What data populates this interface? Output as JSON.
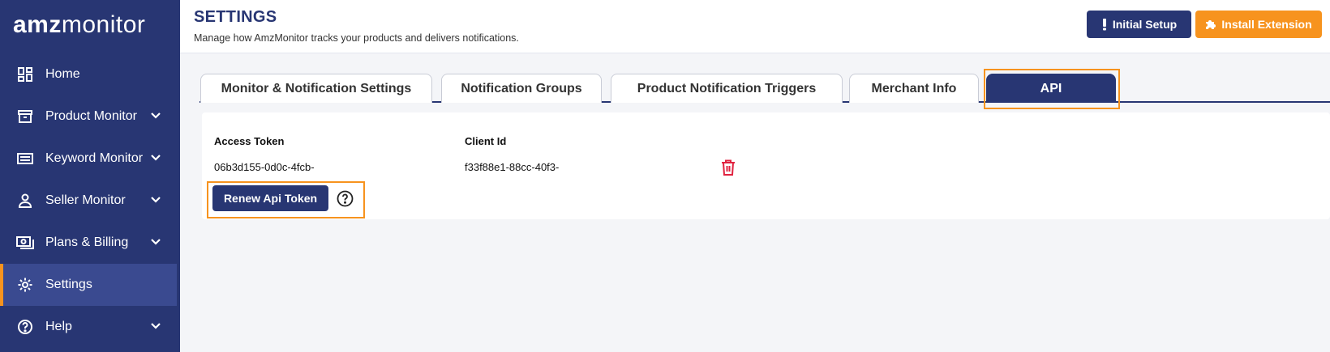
{
  "logo": {
    "part1": "amz",
    "part2": "monitor"
  },
  "sidebar": {
    "items": [
      {
        "label": "Home"
      },
      {
        "label": "Product Monitor"
      },
      {
        "label": "Keyword Monitor"
      },
      {
        "label": "Seller Monitor"
      },
      {
        "label": "Plans & Billing"
      },
      {
        "label": "Settings"
      },
      {
        "label": "Help"
      }
    ]
  },
  "header": {
    "title": "SETTINGS",
    "subtitle": "Manage how AmzMonitor tracks your products and delivers notifications.",
    "initial_setup": "Initial Setup",
    "install_extension": "Install Extension"
  },
  "tabs": [
    {
      "label": "Monitor & Notification Settings"
    },
    {
      "label": "Notification Groups"
    },
    {
      "label": "Product Notification Triggers"
    },
    {
      "label": "Merchant Info"
    },
    {
      "label": "API"
    }
  ],
  "api": {
    "access_token_label": "Access Token",
    "access_token_value": "06b3d155-0d0c-4fcb-",
    "client_id_label": "Client Id",
    "client_id_value": "f33f88e1-88cc-40f3-",
    "renew_button": "Renew Api Token"
  },
  "colors": {
    "navy": "#283673",
    "orange": "#f7931e",
    "danger": "#e0223f"
  },
  "icons": [
    "dashboard-icon",
    "archive-icon",
    "keyboard-icon",
    "user-icon",
    "billing-icon",
    "gear-icon",
    "help-icon",
    "chevron-down-icon",
    "exclamation-icon",
    "puzzle-icon",
    "trash-icon",
    "question-circle-icon"
  ]
}
